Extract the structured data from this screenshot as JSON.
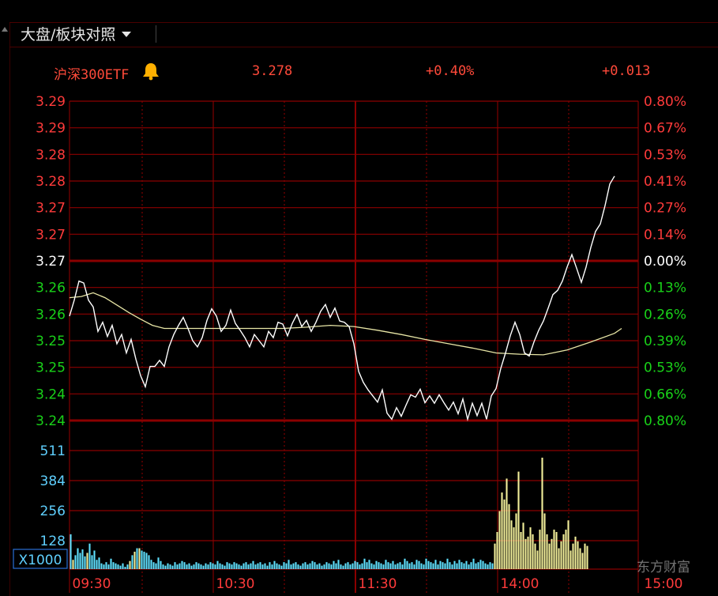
{
  "tab": {
    "label": "大盘/板块对照"
  },
  "header": {
    "name": "沪深300ETF",
    "price": "3.278",
    "change_pct": "+0.40%",
    "change": "+0.013"
  },
  "colors": {
    "up": "#ff3b3b",
    "down": "#19d219",
    "neutral": "#ffffff",
    "grid": "#8b0000",
    "price_line": "#ffffff",
    "avg_line": "#e8e6a6",
    "vol_up": "#f2ef9a",
    "vol_down": "#5fe0ff",
    "vol_axis": "#5fd0ff"
  },
  "price_axis": {
    "left_labels": [
      "3.29",
      "3.29",
      "3.28",
      "3.28",
      "3.27",
      "3.27",
      "3.27",
      "3.26",
      "3.26",
      "3.25",
      "3.25",
      "3.24",
      "3.24"
    ],
    "right_labels": [
      "0.80%",
      "0.67%",
      "0.53%",
      "0.41%",
      "0.27%",
      "0.14%",
      "0.00%",
      "0.13%",
      "0.26%",
      "0.39%",
      "0.53%",
      "0.66%",
      "0.80%"
    ]
  },
  "volume_axis": {
    "labels": [
      "511",
      "384",
      "256",
      "128"
    ],
    "unit": "X1000"
  },
  "time_axis": [
    "09:30",
    "10:30",
    "11:30",
    "14:00",
    "15:00"
  ],
  "chart_data": {
    "type": "line",
    "title": "沪深300ETF",
    "prev_close": 3.265,
    "ylim": [
      3.239,
      3.291
    ],
    "xlim": [
      0,
      240
    ],
    "price": [
      [
        0,
        3.256
      ],
      [
        2,
        3.2586
      ],
      [
        4,
        3.2617
      ],
      [
        6,
        3.2614
      ],
      [
        8,
        3.2586
      ],
      [
        10,
        3.2575
      ],
      [
        12,
        3.2535
      ],
      [
        14,
        3.255
      ],
      [
        16,
        3.2527
      ],
      [
        18,
        3.2545
      ],
      [
        20,
        3.2515
      ],
      [
        22,
        3.253
      ],
      [
        24,
        3.25
      ],
      [
        26,
        3.2522
      ],
      [
        28,
        3.249
      ],
      [
        30,
        3.2463
      ],
      [
        32,
        3.2445
      ],
      [
        34,
        3.2478
      ],
      [
        36,
        3.2478
      ],
      [
        38,
        3.2488
      ],
      [
        40,
        3.2478
      ],
      [
        42,
        3.251
      ],
      [
        44,
        3.253
      ],
      [
        46,
        3.2545
      ],
      [
        48,
        3.2558
      ],
      [
        50,
        3.254
      ],
      [
        52,
        3.252
      ],
      [
        54,
        3.251
      ],
      [
        56,
        3.2525
      ],
      [
        58,
        3.2553
      ],
      [
        60,
        3.2572
      ],
      [
        62,
        3.256
      ],
      [
        64,
        3.2535
      ],
      [
        66,
        3.2545
      ],
      [
        68,
        3.257
      ],
      [
        70,
        3.2548
      ],
      [
        72,
        3.2537
      ],
      [
        74,
        3.2525
      ],
      [
        76,
        3.251
      ],
      [
        78,
        3.253
      ],
      [
        80,
        3.252
      ],
      [
        82,
        3.251
      ],
      [
        84,
        3.2535
      ],
      [
        86,
        3.2525
      ],
      [
        88,
        3.255
      ],
      [
        90,
        3.2547
      ],
      [
        92,
        3.2528
      ],
      [
        94,
        3.2548
      ],
      [
        96,
        3.2563
      ],
      [
        98,
        3.2543
      ],
      [
        100,
        3.2553
      ],
      [
        102,
        3.2535
      ],
      [
        104,
        3.255
      ],
      [
        106,
        3.2568
      ],
      [
        108,
        3.2579
      ],
      [
        110,
        3.2558
      ],
      [
        112,
        3.2573
      ],
      [
        114,
        3.2552
      ],
      [
        116,
        3.255
      ],
      [
        118,
        3.2543
      ],
      [
        120,
        3.2515
      ],
      [
        122,
        3.247
      ],
      [
        124,
        3.2452
      ],
      [
        126,
        3.244
      ],
      [
        128,
        3.243
      ],
      [
        130,
        3.242
      ],
      [
        132,
        3.244
      ],
      [
        134,
        3.2402
      ],
      [
        136,
        3.2392
      ],
      [
        138,
        3.2411
      ],
      [
        140,
        3.2397
      ],
      [
        142,
        3.2415
      ],
      [
        144,
        3.2432
      ],
      [
        146,
        3.2428
      ],
      [
        148,
        3.2441
      ],
      [
        150,
        3.2419
      ],
      [
        152,
        3.243
      ],
      [
        154,
        3.2418
      ],
      [
        156,
        3.2432
      ],
      [
        158,
        3.2419
      ],
      [
        160,
        3.2407
      ],
      [
        162,
        3.242
      ],
      [
        164,
        3.2401
      ],
      [
        166,
        3.2425
      ],
      [
        168,
        3.2392
      ],
      [
        170,
        3.2418
      ],
      [
        172,
        3.2398
      ],
      [
        174,
        3.2418
      ],
      [
        176,
        3.2392
      ],
      [
        178,
        3.243
      ],
      [
        180,
        3.2442
      ],
      [
        182,
        3.2475
      ],
      [
        184,
        3.25
      ],
      [
        186,
        3.2528
      ],
      [
        188,
        3.255
      ],
      [
        190,
        3.253
      ],
      [
        192,
        3.25
      ],
      [
        194,
        3.2495
      ],
      [
        196,
        3.2518
      ],
      [
        198,
        3.2537
      ],
      [
        200,
        3.2552
      ],
      [
        202,
        3.2573
      ],
      [
        204,
        3.2595
      ],
      [
        206,
        3.2602
      ],
      [
        208,
        3.2617
      ],
      [
        210,
        3.264
      ],
      [
        212,
        3.266
      ],
      [
        214,
        3.2638
      ],
      [
        216,
        3.2615
      ],
      [
        218,
        3.264
      ],
      [
        220,
        3.2672
      ],
      [
        222,
        3.2698
      ],
      [
        224,
        3.271
      ],
      [
        226,
        3.274
      ],
      [
        228,
        3.2775
      ],
      [
        230,
        3.2788
      ]
    ],
    "avg": [
      [
        0,
        3.259
      ],
      [
        5,
        3.2592
      ],
      [
        10,
        3.2598
      ],
      [
        15,
        3.259
      ],
      [
        20,
        3.2578
      ],
      [
        25,
        3.2566
      ],
      [
        30,
        3.2555
      ],
      [
        35,
        3.2545
      ],
      [
        40,
        3.254
      ],
      [
        45,
        3.254
      ],
      [
        50,
        3.254
      ],
      [
        60,
        3.254
      ],
      [
        70,
        3.254
      ],
      [
        80,
        3.254
      ],
      [
        90,
        3.254
      ],
      [
        100,
        3.2542
      ],
      [
        110,
        3.2545
      ],
      [
        120,
        3.2543
      ],
      [
        130,
        3.2537
      ],
      [
        140,
        3.253
      ],
      [
        150,
        3.2522
      ],
      [
        160,
        3.2515
      ],
      [
        170,
        3.2508
      ],
      [
        180,
        3.25
      ],
      [
        190,
        3.2498
      ],
      [
        200,
        3.2497
      ],
      [
        210,
        3.2505
      ],
      [
        220,
        3.2518
      ],
      [
        230,
        3.2532
      ],
      [
        233,
        3.254
      ]
    ],
    "volume_up": [
      0,
      40,
      0,
      0,
      0,
      0,
      0,
      70,
      0,
      0,
      0,
      0,
      0,
      0,
      0,
      0,
      0,
      0,
      0,
      0,
      0,
      0,
      0,
      0,
      0,
      35,
      0,
      75,
      0,
      90,
      0,
      0,
      0,
      0,
      0,
      0,
      0,
      0,
      0,
      0,
      0,
      0,
      0,
      0,
      0,
      0,
      0,
      0,
      0,
      0,
      0,
      0,
      0,
      0,
      0,
      0,
      0,
      0,
      0,
      0,
      0,
      0,
      0,
      0,
      0,
      0,
      0,
      0,
      0,
      0,
      0,
      0,
      0,
      0,
      0,
      0,
      0,
      0,
      0,
      0,
      0,
      0,
      0,
      0,
      0,
      0,
      0,
      0,
      0,
      0,
      0,
      0,
      0,
      0,
      0,
      0,
      0,
      0,
      0,
      0,
      0,
      0,
      0,
      0,
      0,
      0,
      0,
      0,
      0,
      0,
      0,
      0,
      0,
      0,
      0,
      0,
      0,
      0,
      0,
      0,
      0,
      0,
      0,
      0,
      0,
      0,
      0,
      0,
      0,
      0,
      0,
      0,
      0,
      0,
      0,
      0,
      0,
      0,
      0,
      0,
      0,
      0,
      0,
      0,
      0,
      0,
      0,
      0,
      0,
      0,
      0,
      0,
      0,
      0,
      0,
      0,
      0,
      0,
      0,
      0,
      0,
      0,
      0,
      0,
      0,
      0,
      0,
      0,
      0,
      0,
      0,
      0,
      0,
      0,
      0,
      0,
      0,
      0,
      0,
      110,
      160,
      250,
      330,
      300,
      390,
      280,
      210,
      180,
      240,
      420,
      160,
      200,
      130,
      140,
      180,
      150,
      110,
      80,
      170,
      480,
      240,
      150,
      110,
      130,
      170,
      160,
      90,
      120,
      150,
      170,
      210,
      80,
      110,
      140,
      120,
      90,
      70,
      110,
      100,
      0,
      0,
      0,
      0,
      0,
      0,
      0,
      0,
      0,
      0,
      0,
      0
    ],
    "volume_down": [
      150,
      0,
      60,
      90,
      70,
      85,
      55,
      0,
      110,
      60,
      80,
      40,
      50,
      25,
      20,
      30,
      20,
      45,
      30,
      25,
      20,
      15,
      25,
      10,
      20,
      0,
      60,
      0,
      90,
      0,
      80,
      75,
      70,
      60,
      40,
      30,
      25,
      50,
      35,
      20,
      15,
      25,
      20,
      15,
      30,
      20,
      25,
      35,
      30,
      20,
      25,
      15,
      20,
      30,
      25,
      20,
      15,
      25,
      20,
      30,
      25,
      20,
      35,
      25,
      20,
      15,
      30,
      25,
      20,
      30,
      25,
      20,
      15,
      25,
      30,
      20,
      25,
      35,
      20,
      25,
      30,
      20,
      25,
      15,
      30,
      20,
      35,
      25,
      20,
      15,
      30,
      25,
      40,
      20,
      25,
      30,
      20,
      15,
      25,
      30,
      20,
      25,
      35,
      30,
      20,
      25,
      15,
      20,
      30,
      25,
      20,
      35,
      25,
      40,
      20,
      15,
      25,
      30,
      20,
      25,
      35,
      30,
      20,
      25,
      45,
      30,
      40,
      25,
      20,
      35,
      30,
      25,
      20,
      40,
      30,
      25,
      35,
      20,
      25,
      30,
      20,
      45,
      35,
      25,
      30,
      20,
      40,
      35,
      25,
      20,
      45,
      35,
      30,
      25,
      40,
      20,
      35,
      30,
      25,
      45,
      30,
      20,
      35,
      25,
      40,
      30,
      25,
      35,
      20,
      30,
      45,
      25,
      30,
      40,
      35,
      25,
      20,
      30,
      25,
      40,
      0,
      0,
      0,
      0,
      0,
      0,
      0,
      0,
      0,
      0,
      0,
      0,
      0,
      0,
      0,
      0,
      0,
      0,
      0,
      0,
      0,
      0,
      0,
      0,
      0,
      0,
      0,
      0,
      0,
      0,
      0,
      0,
      0,
      0,
      0,
      0,
      0,
      0,
      0,
      0,
      0,
      0,
      0,
      0,
      0,
      0,
      0,
      0,
      0,
      0,
      0,
      0,
      0,
      0
    ]
  },
  "watermark": {
    "text": "东方财富"
  }
}
